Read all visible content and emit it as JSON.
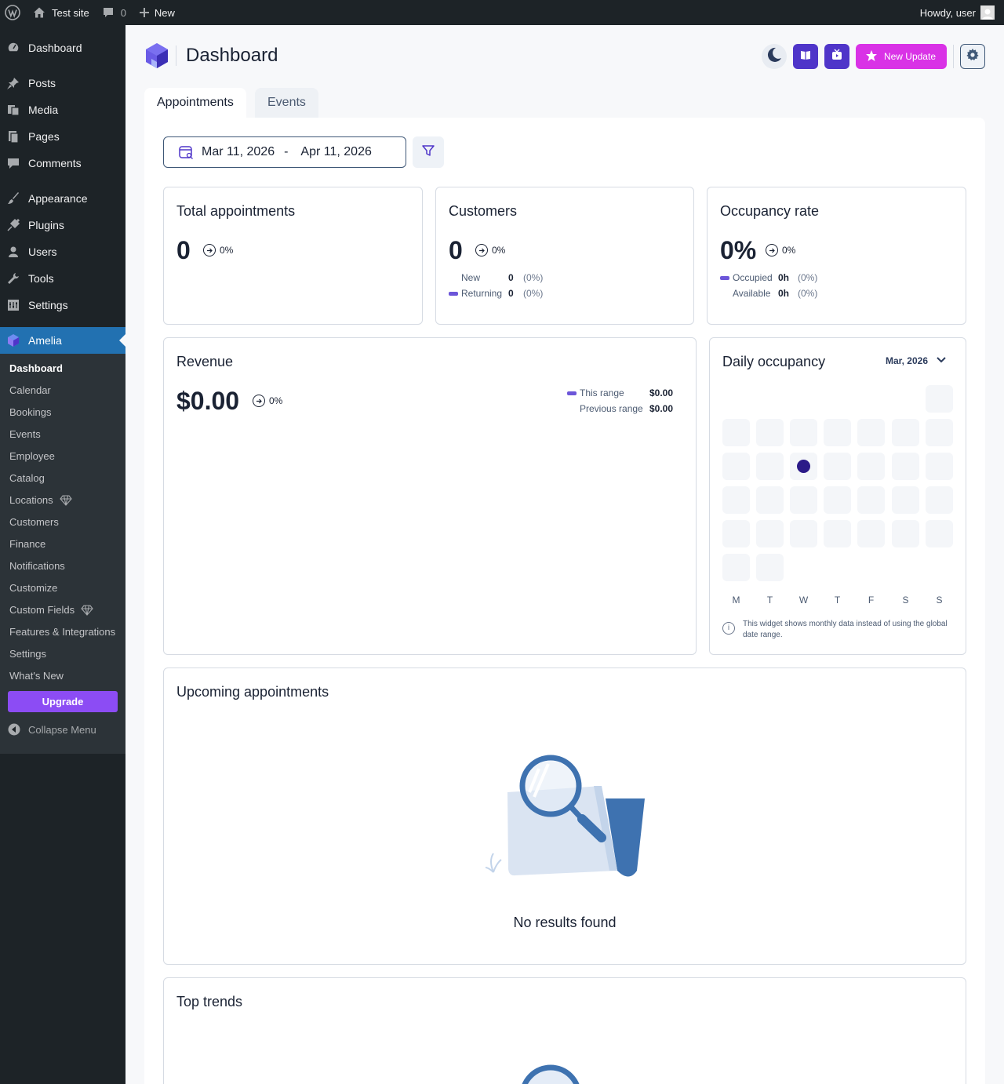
{
  "admin_bar": {
    "site_name": "Test site",
    "comments_count": "0",
    "new_label": "New",
    "greeting": "Howdy, user"
  },
  "sidebar": {
    "items": [
      {
        "label": "Dashboard",
        "icon": "dashboard-icon"
      },
      {
        "label": "Posts",
        "icon": "pin-icon"
      },
      {
        "label": "Media",
        "icon": "media-icon"
      },
      {
        "label": "Pages",
        "icon": "pages-icon"
      },
      {
        "label": "Comments",
        "icon": "comment-icon"
      },
      {
        "label": "Appearance",
        "icon": "brush-icon"
      },
      {
        "label": "Plugins",
        "icon": "plugin-icon"
      },
      {
        "label": "Users",
        "icon": "user-icon"
      },
      {
        "label": "Tools",
        "icon": "wrench-icon"
      },
      {
        "label": "Settings",
        "icon": "settings-icon"
      },
      {
        "label": "Amelia",
        "icon": "amelia-logo-icon"
      }
    ],
    "submenu": [
      {
        "label": "Dashboard"
      },
      {
        "label": "Calendar"
      },
      {
        "label": "Bookings"
      },
      {
        "label": "Events"
      },
      {
        "label": "Employee"
      },
      {
        "label": "Catalog"
      },
      {
        "label": "Locations",
        "badge": "gem-icon"
      },
      {
        "label": "Customers"
      },
      {
        "label": "Finance"
      },
      {
        "label": "Notifications"
      },
      {
        "label": "Customize"
      },
      {
        "label": "Custom Fields",
        "badge": "gem-icon"
      },
      {
        "label": "Features & Integrations"
      },
      {
        "label": "Settings"
      },
      {
        "label": "What's New"
      }
    ],
    "upgrade_label": "Upgrade",
    "collapse_label": "Collapse Menu"
  },
  "header": {
    "title": "Dashboard",
    "new_update_label": "New Update"
  },
  "tabs": [
    {
      "label": "Appointments",
      "active": true
    },
    {
      "label": "Events",
      "active": false
    }
  ],
  "filters": {
    "date_from": "Mar 11, 2026",
    "date_separator": "-",
    "date_to": "Apr 11, 2026"
  },
  "stats": {
    "total_appointments": {
      "title": "Total appointments",
      "value": "0",
      "trend": "0%"
    },
    "customers": {
      "title": "Customers",
      "value": "0",
      "trend": "0%",
      "rows": [
        {
          "label": "New",
          "value": "0",
          "percent": "(0%)"
        },
        {
          "label": "Returning",
          "value": "0",
          "percent": "(0%)"
        }
      ]
    },
    "occupancy": {
      "title": "Occupancy rate",
      "value": "0%",
      "trend": "0%",
      "rows": [
        {
          "label": "Occupied",
          "value": "0h",
          "percent": "(0%)"
        },
        {
          "label": "Available",
          "value": "0h",
          "percent": "(0%)"
        }
      ]
    }
  },
  "revenue": {
    "title": "Revenue",
    "value": "$0.00",
    "trend": "0%",
    "legend": [
      {
        "label": "This range",
        "value": "$0.00"
      },
      {
        "label": "Previous range",
        "value": "$0.00"
      }
    ]
  },
  "daily_occupancy": {
    "title": "Daily occupancy",
    "month": "Mar, 2026",
    "weekdays": [
      "M",
      "T",
      "W",
      "T",
      "F",
      "S",
      "S"
    ],
    "note": "This widget shows monthly data instead of using the global date range."
  },
  "upcoming": {
    "title": "Upcoming appointments",
    "empty_text": "No results found"
  },
  "top_trends": {
    "title": "Top trends"
  },
  "colors": {
    "wp_dark": "#1d2327",
    "wp_blue": "#2271b1",
    "amelia_purple": "#4f35c9",
    "new_update_pink": "#d932e6",
    "upgrade_purple": "#8c4cf4",
    "legend_purple": "#6c56d9"
  }
}
